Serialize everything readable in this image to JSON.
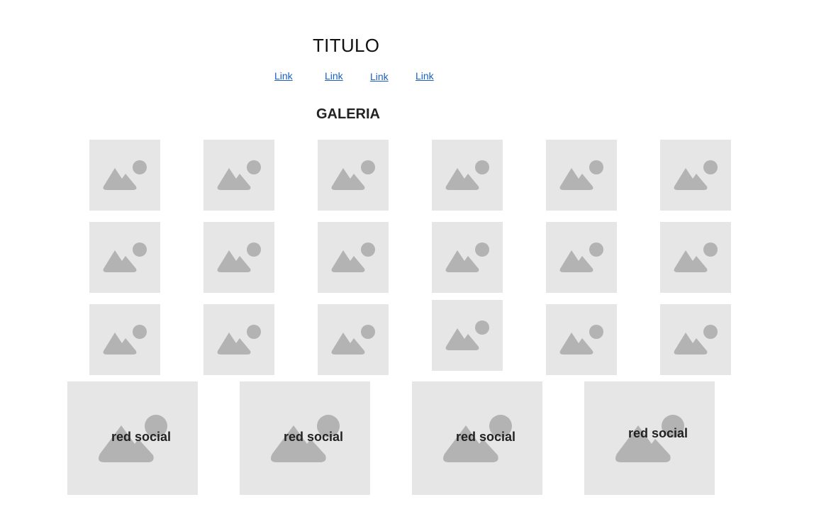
{
  "header": {
    "title": "TITULO"
  },
  "nav": {
    "links": [
      "Link",
      "Link",
      "Link",
      "Link"
    ]
  },
  "gallery": {
    "heading": "GALERIA",
    "thumbnail_icon": "image-placeholder-icon",
    "rows": 3,
    "columns": 6
  },
  "social": {
    "items": [
      {
        "label": "red social",
        "icon": "image-placeholder-icon"
      },
      {
        "label": "red social",
        "icon": "image-placeholder-icon"
      },
      {
        "label": "red social",
        "icon": "image-placeholder-icon"
      },
      {
        "label": "red social",
        "icon": "image-placeholder-icon"
      }
    ]
  },
  "colors": {
    "placeholder_bg": "#e6e6e6",
    "placeholder_icon": "#b3b3b3",
    "link": "#1a5fc4"
  }
}
